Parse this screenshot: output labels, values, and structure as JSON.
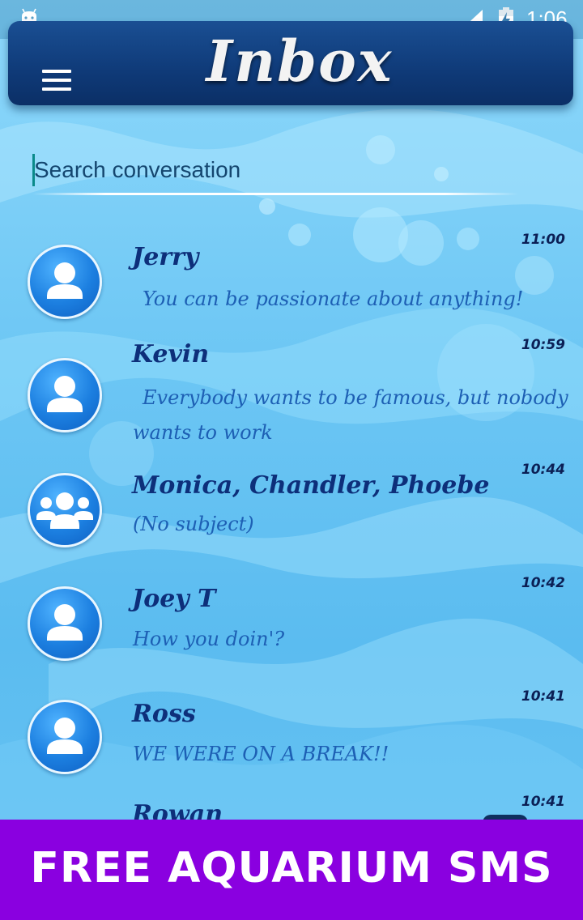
{
  "status_bar": {
    "time": "1:06"
  },
  "app_bar": {
    "title": "Inbox"
  },
  "search": {
    "placeholder": "Search conversation"
  },
  "conversations": [
    {
      "name": "Jerry",
      "message": "You can be passionate about anything!",
      "time": "11:00",
      "avatar": "single-person-icon"
    },
    {
      "name": "Kevin",
      "message": "Everybody wants to be famous, but nobody wants to work",
      "time": "10:59",
      "avatar": "single-person-icon"
    },
    {
      "name": "Monica, Chandler, Phoebe",
      "message": "(No subject)",
      "time": "10:44",
      "avatar": "group-icon"
    },
    {
      "name": "Joey T",
      "message": "How you doin'?",
      "time": "10:42",
      "avatar": "single-person-icon"
    },
    {
      "name": "Ross",
      "message": "WE WERE ON A BREAK!!",
      "time": "10:41",
      "avatar": "single-person-icon"
    },
    {
      "name": "Rowan",
      "message": "",
      "time": "10:41",
      "avatar": "single-person-icon"
    }
  ],
  "banner": {
    "text": "FREE AQUARIUM SMS"
  },
  "colors": {
    "app_bar": "#0f3a78",
    "name_text": "#0d2f7a",
    "message_text": "#1d5fb4",
    "banner": "#8a00e0"
  }
}
